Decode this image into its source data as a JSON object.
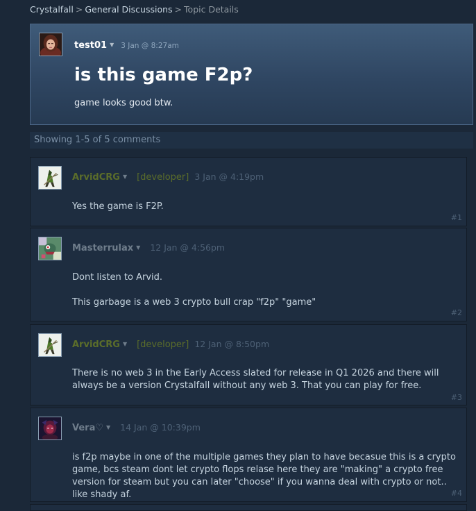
{
  "breadcrumb": {
    "items": [
      "Crystalfall",
      "General Discussions",
      "Topic Details"
    ],
    "separator": ">"
  },
  "topic": {
    "author": "test01",
    "date": "3 Jan @ 8:27am",
    "title": "is this game F2p?",
    "body": "game looks good btw."
  },
  "showing": "Showing 1-5 of 5 comments",
  "comments": [
    {
      "author": "ArvidCRG",
      "badge": "[developer]",
      "date": "3 Jan @ 4:19pm",
      "body": [
        "Yes the game is F2P."
      ],
      "number": "#1"
    },
    {
      "author": "Masterrulax",
      "date": "12 Jan @ 4:56pm",
      "body": [
        "Dont listen to Arvid.",
        "This garbage is a web 3 crypto bull crap \"f2p\" \"game\""
      ],
      "number": "#2"
    },
    {
      "author": "ArvidCRG",
      "badge": "[developer]",
      "date": "12 Jan @ 8:50pm",
      "body": [
        "There is no web 3 in the Early Access slated for release in Q1 2026 and there will always be a version Crystalfall without any web 3. That you can play for free."
      ],
      "number": "#3"
    },
    {
      "author": "Vera♡",
      "date": "14 Jan @ 10:39pm",
      "body": [
        "is f2p maybe in one of the multiple games they plan to have becasue this is a crypto game, bcs steam dont let crypto flops relase here they are \"making\" a crypto free version for steam but you can later \"choose\" if you wanna deal with crypto or not.. like shady af."
      ],
      "number": "#4"
    }
  ],
  "colors": {
    "page_bg": "#1b2838",
    "developer": "#5b6d2a",
    "muted": "#4e6176"
  },
  "icons": {
    "caret": "dropdown-caret-icon"
  }
}
